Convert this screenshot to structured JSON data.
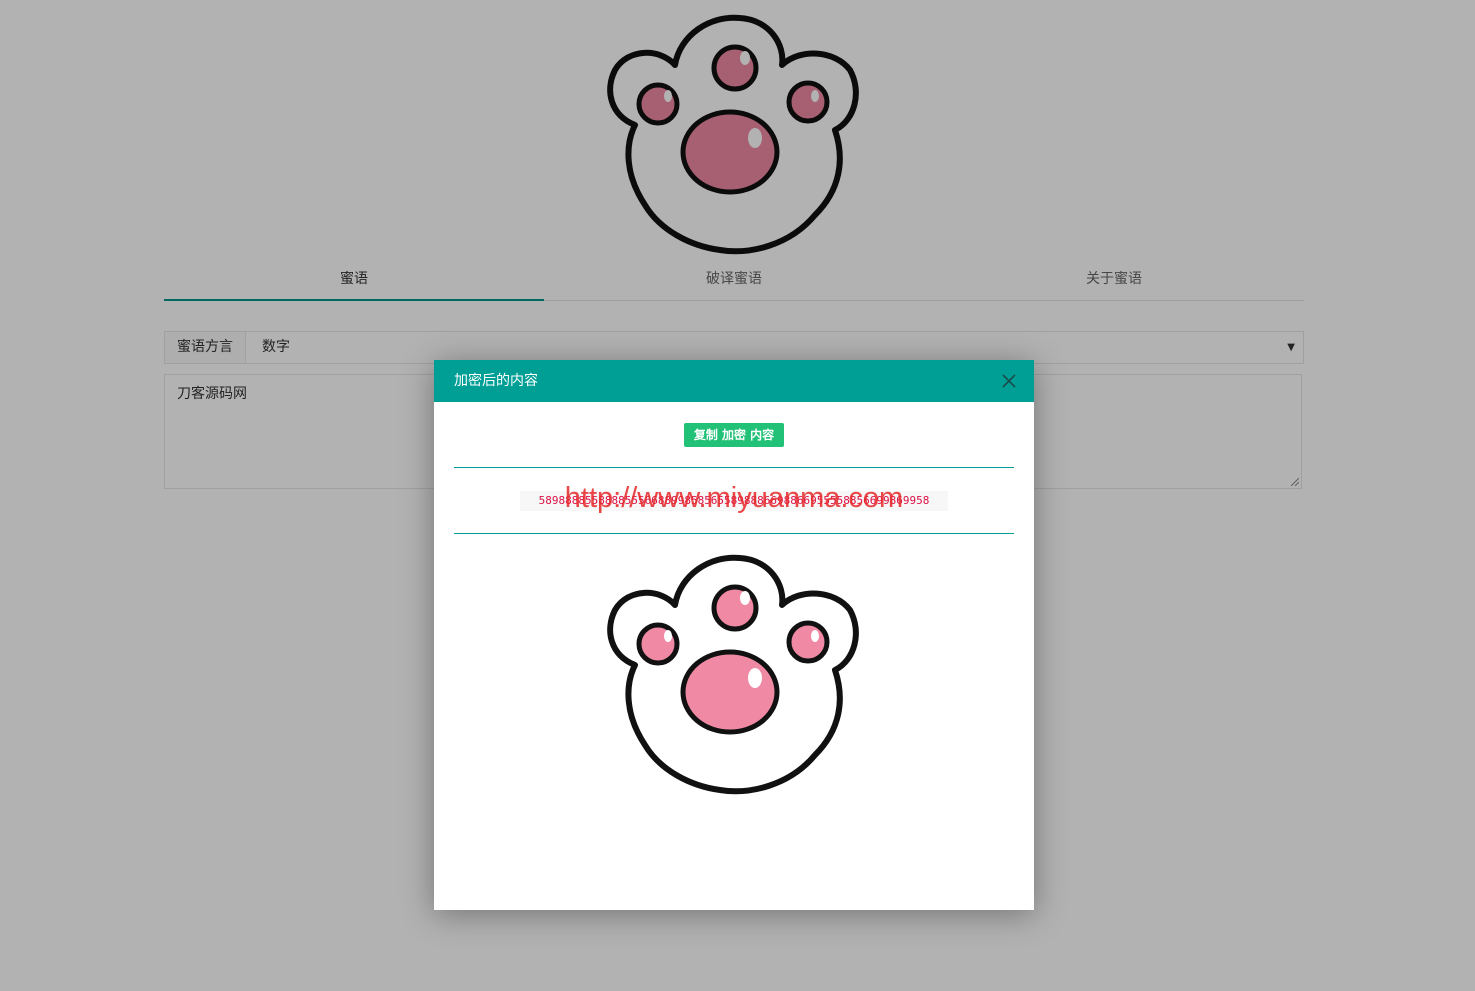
{
  "tabs": [
    {
      "label": "蜜语",
      "active": true
    },
    {
      "label": "破译蜜语",
      "active": false
    },
    {
      "label": "关于蜜语",
      "active": false
    }
  ],
  "form": {
    "dialect_label": "蜜语方言",
    "dialect_value": "数字",
    "input_text": "刀客源码网"
  },
  "modal": {
    "title": "加密后的内容",
    "copy_button": "复制 加密 内容",
    "cipher_text": "58988885588885556688998585655898886698866955558856699869958",
    "watermark": "http://www.miyuanma.com"
  },
  "colors": {
    "accent": "#009688",
    "header": "#009f95",
    "copy_button": "#21c277",
    "cipher_text": "#dd1144",
    "paw_pad": "#f08aa4"
  },
  "icons": {
    "logo": "cat-paw-icon",
    "close": "close-icon",
    "dropdown": "triangle-down-icon"
  }
}
